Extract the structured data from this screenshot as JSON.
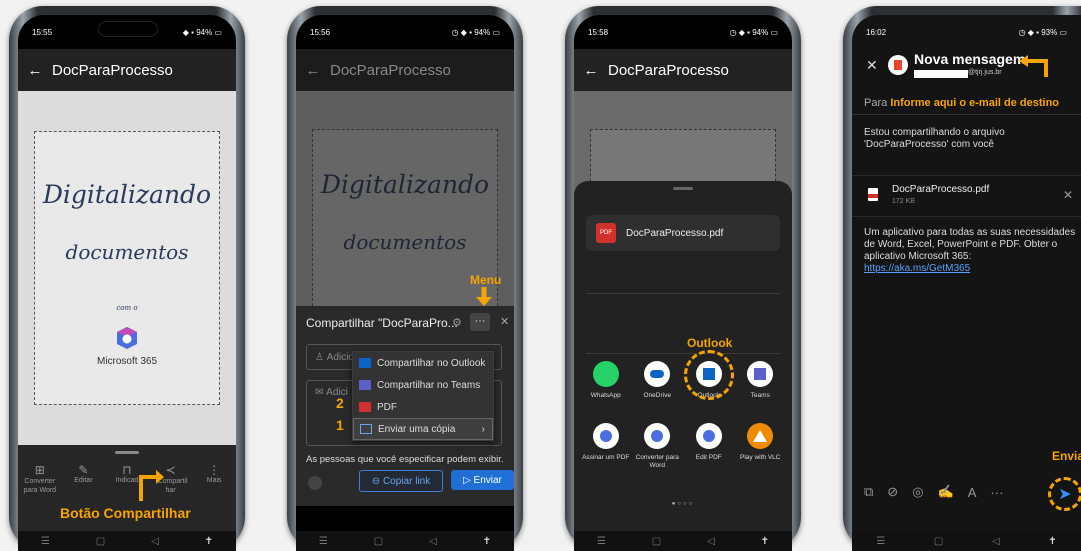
{
  "phone1": {
    "time": "15:55",
    "title": "DocParaProcesso",
    "doc": {
      "line1": "Digitalizando",
      "line2": "documentos",
      "com": "com o",
      "brand": "Microsoft 365"
    },
    "toolbar": [
      {
        "label": "Converter para Word",
        "icon": "word-convert-icon"
      },
      {
        "label": "Editar",
        "icon": "pencil-icon"
      },
      {
        "label": "Indicad",
        "icon": "bookmark-icon"
      },
      {
        "label": "Compartil har",
        "icon": "share-icon"
      },
      {
        "label": "Mais",
        "icon": "more-vertical-icon"
      }
    ],
    "annotation": "Botão Compartilhar"
  },
  "phone2": {
    "time": "15:56",
    "title": "DocParaProcesso",
    "doc": {
      "line1": "Digitalizando",
      "line2": "documentos"
    },
    "menu_annotation": "Menu",
    "sheet_title": "Compartilhar \"DocParaPro...",
    "input1_placeholder": "Adicio",
    "input2_placeholder": "Adici",
    "menu_items": [
      {
        "label": "Compartilhar no Outlook",
        "icon": "outlook-icon"
      },
      {
        "label": "Compartilhar no Teams",
        "icon": "teams-icon"
      },
      {
        "label": "PDF",
        "icon": "pdf-icon",
        "marker": "2"
      },
      {
        "label": "Enviar uma cópia",
        "icon": "send-copy-icon",
        "marker": "1"
      }
    ],
    "footer_text": "As pessoas que você especificar podem exibir.",
    "copy_link": "Copiar link",
    "send": "Enviar"
  },
  "phone3": {
    "time": "15:58",
    "title": "DocParaProcesso",
    "file": "DocParaProcesso.pdf",
    "pdf_badge": "PDF",
    "outlook_annotation": "Outlook",
    "apps_row1": [
      {
        "label": "WhatsApp",
        "icon": "whatsapp-icon",
        "color": "#25d366"
      },
      {
        "label": "OneDrive",
        "icon": "onedrive-icon",
        "color": "#ffffff"
      },
      {
        "label": "Outlook",
        "icon": "outlook-icon",
        "color": "#ffffff"
      },
      {
        "label": "Teams",
        "icon": "teams-icon",
        "color": "#ffffff"
      }
    ],
    "apps_row2": [
      {
        "label": "Assinar um PDF",
        "icon": "m365-icon"
      },
      {
        "label": "Converter para Word",
        "icon": "m365-icon"
      },
      {
        "label": "Edit PDF",
        "icon": "m365-icon"
      },
      {
        "label": "Play with VLC",
        "icon": "vlc-icon"
      }
    ]
  },
  "phone4": {
    "time": "16:02",
    "title": "Nova mensagem",
    "account": "@tjrj.jus.br",
    "to_label": "Para",
    "to_hint": "Informe aqui o e-mail de destino",
    "body1": "Estou compartilhando o arquivo 'DocParaProcesso' com você",
    "attachment": "DocParaProcesso.pdf",
    "attachment_size": "172 KB",
    "body2": "Um aplicativo para todas as suas necessidades de Word, Excel, PowerPoint e PDF. Obter o aplicativo Microsoft 365:",
    "link": "https://aka.ms/GetM365",
    "send_annotation": "Enviar"
  },
  "colors": {
    "accent": "#f6a400",
    "send_blue": "#1f6fd6",
    "outlook_blue": "#0a64c8"
  }
}
